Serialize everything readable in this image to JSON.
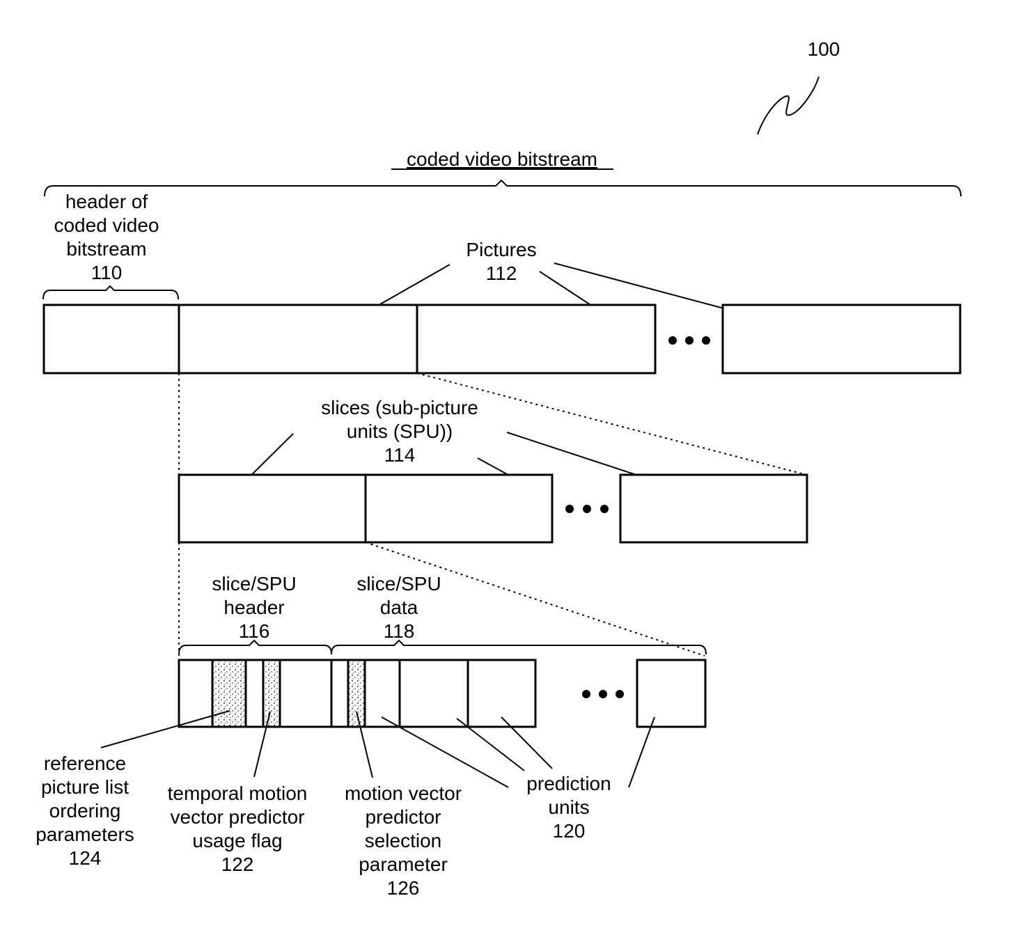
{
  "figure": {
    "reference_numeral": "100",
    "title": "coded video bitstream",
    "header_label": [
      "header of",
      "coded video",
      "bitstream",
      "110"
    ],
    "pictures_label": [
      "Pictures",
      "112"
    ],
    "slices_label": [
      "slices (sub-picture",
      "units (SPU))",
      "114"
    ],
    "slice_header_label": [
      "slice/SPU",
      "header",
      "116"
    ],
    "slice_data_label": [
      "slice/SPU",
      "data",
      "118"
    ],
    "ref_list_label": [
      "reference",
      "picture list",
      "ordering",
      "parameters",
      "124"
    ],
    "tmvp_flag_label": [
      "temporal motion",
      "vector predictor",
      "usage flag",
      "122"
    ],
    "mvp_sel_label": [
      "motion vector",
      "predictor",
      "selection",
      "parameter",
      "126"
    ],
    "pred_units_label": [
      "prediction",
      "units",
      "120"
    ]
  }
}
